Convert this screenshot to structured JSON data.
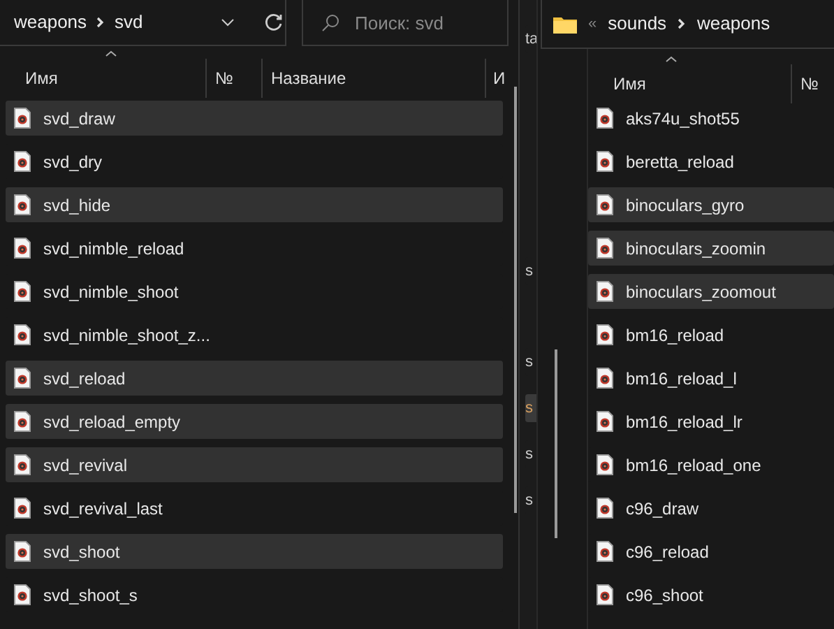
{
  "left_window": {
    "breadcrumb": [
      "weapons",
      "svd"
    ],
    "search": {
      "placeholder": "Поиск: svd"
    },
    "columns": [
      "Имя",
      "№",
      "Название",
      "И"
    ],
    "files": [
      {
        "name": "svd_draw",
        "selected": true
      },
      {
        "name": "svd_dry",
        "selected": false
      },
      {
        "name": "svd_hide",
        "selected": true
      },
      {
        "name": "svd_nimble_reload",
        "selected": false
      },
      {
        "name": "svd_nimble_shoot",
        "selected": false
      },
      {
        "name": "svd_nimble_shoot_z...",
        "selected": false
      },
      {
        "name": "svd_reload",
        "selected": true
      },
      {
        "name": "svd_reload_empty",
        "selected": true
      },
      {
        "name": "svd_revival",
        "selected": true
      },
      {
        "name": "svd_revival_last",
        "selected": false
      },
      {
        "name": "svd_shoot",
        "selected": true
      },
      {
        "name": "svd_shoot_s",
        "selected": false
      }
    ]
  },
  "background_window": {
    "fragments": [
      {
        "text": "ta",
        "selected": false
      },
      {
        "text": "s",
        "selected": false
      },
      {
        "text": "s",
        "selected": false
      },
      {
        "text": "s",
        "selected": true
      },
      {
        "text": "s",
        "selected": false
      },
      {
        "text": "s",
        "selected": false
      }
    ]
  },
  "right_window": {
    "breadcrumb": [
      "sounds",
      "weapons"
    ],
    "overflow": "«",
    "columns": [
      "Имя",
      "№"
    ],
    "files": [
      {
        "name": "aks74u_shot55",
        "selected": false
      },
      {
        "name": "beretta_reload",
        "selected": false
      },
      {
        "name": "binoculars_gyro",
        "selected": true
      },
      {
        "name": "binoculars_zoomin",
        "selected": true
      },
      {
        "name": "binoculars_zoomout",
        "selected": true
      },
      {
        "name": "bm16_reload",
        "selected": false
      },
      {
        "name": "bm16_reload_l",
        "selected": false
      },
      {
        "name": "bm16_reload_lr",
        "selected": false
      },
      {
        "name": "bm16_reload_one",
        "selected": false
      },
      {
        "name": "c96_draw",
        "selected": false
      },
      {
        "name": "c96_reload",
        "selected": false
      },
      {
        "name": "c96_shoot",
        "selected": false
      }
    ]
  }
}
